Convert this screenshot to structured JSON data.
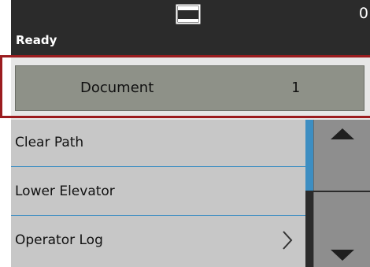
{
  "header": {
    "tray_icon": "output-tray-icon",
    "count": "0",
    "status": "Ready"
  },
  "selection": {
    "label": "Document",
    "count": "1"
  },
  "menu": {
    "items": [
      {
        "label": "Clear Path"
      },
      {
        "label": "Lower Elevator"
      },
      {
        "label": "Operator Log",
        "icon": "chevron-right-icon"
      }
    ]
  },
  "scrollbar": {
    "up_icon": "arrow-up-icon",
    "down_icon": "arrow-down-icon"
  },
  "colors": {
    "header_bg": "#2b2b2b",
    "selected_button": "#8e9188",
    "menu_bg": "#c7c7c7",
    "accent_blue": "#3d8ec2",
    "highlight_red": "#9b1c1f"
  }
}
